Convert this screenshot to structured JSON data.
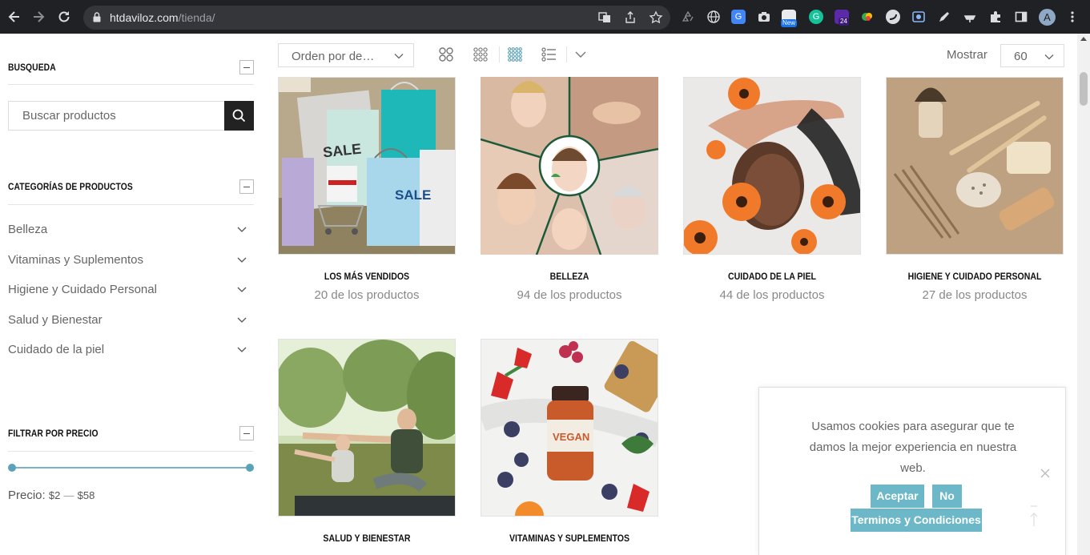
{
  "browser": {
    "url_domain": "htdaviloz.com",
    "url_path": "/tienda/",
    "profile_initial": "A",
    "ext_badge_new": "New",
    "ext_badge_count": "24"
  },
  "sidebar": {
    "search": {
      "title": "BUSQUEDA",
      "placeholder": "Buscar productos"
    },
    "categories": {
      "title": "CATEGORÍAS DE PRODUCTOS",
      "items": [
        {
          "label": "Belleza"
        },
        {
          "label": "Vitaminas y Suplementos"
        },
        {
          "label": "Higiene y Cuidado Personal"
        },
        {
          "label": "Salud y Bienestar"
        },
        {
          "label": "Cuidado de la piel"
        }
      ]
    },
    "price_filter": {
      "title": "FILTRAR POR PRECIO",
      "label": "Precio:",
      "min": "$2",
      "separator": "—",
      "max": "$58"
    }
  },
  "toolbar": {
    "sort_label": "Orden por de…",
    "show_label": "Mostrar",
    "per_page": "60"
  },
  "products": [
    {
      "title": "LOS MÁS VENDIDOS",
      "count": "20 de los productos",
      "tag": "SALE"
    },
    {
      "title": "BELLEZA",
      "count": "94 de los productos"
    },
    {
      "title": "CUIDADO DE LA PIEL",
      "count": "44 de los productos"
    },
    {
      "title": "HIGIENE Y CUIDADO PERSONAL",
      "count": "27 de los productos"
    },
    {
      "title": "SALUD Y BIENESTAR",
      "count": ""
    },
    {
      "title": "VITAMINAS Y SUPLEMENTOS",
      "count": "",
      "tag": "VEGAN"
    }
  ],
  "cookie": {
    "message": "Usamos cookies para asegurar que te damos la mejor experiencia en nuestra web.",
    "accept": "Aceptar",
    "decline": "No",
    "terms": "Terminos y Condiciones"
  }
}
